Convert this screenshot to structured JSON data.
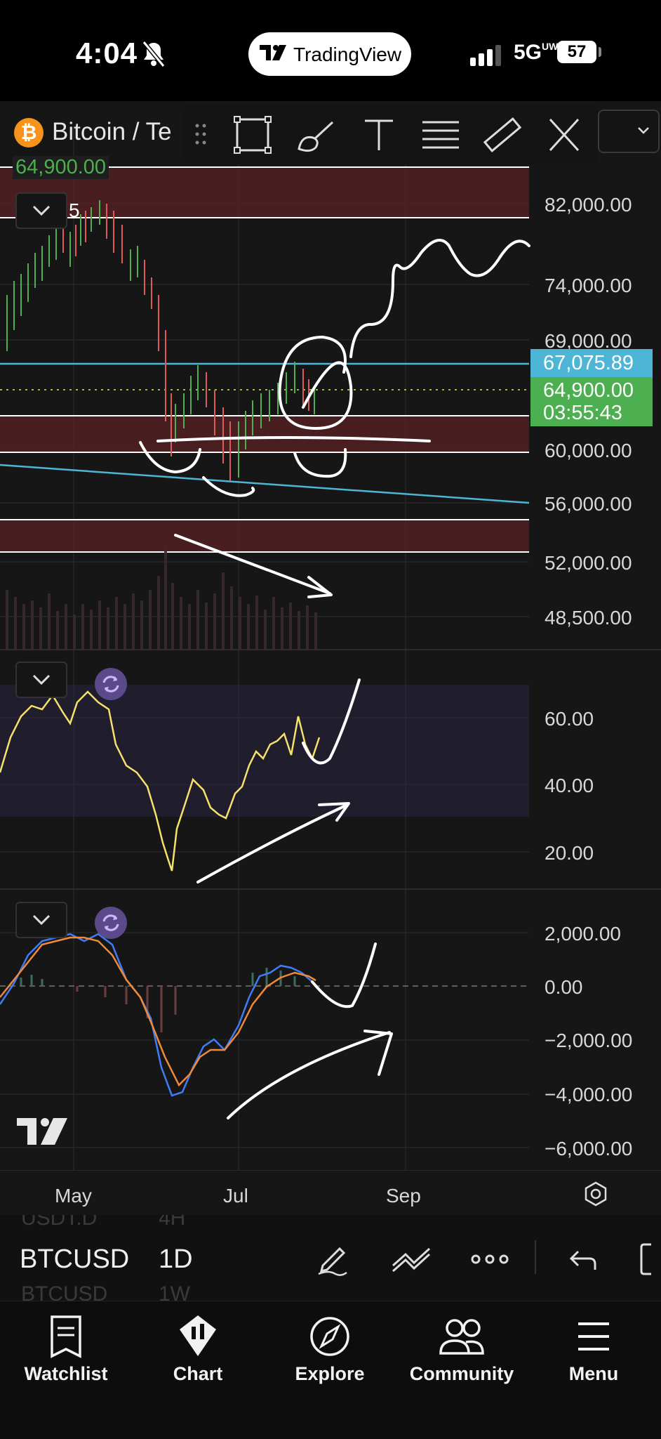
{
  "status_bar": {
    "time": "4:04",
    "network": "5G",
    "network_sub": "UW",
    "battery": "57"
  },
  "app_pill": {
    "label": "TradingView"
  },
  "header": {
    "coin_glyph": "₿",
    "symbol_title": "Bitcoin / Te",
    "last_price": "64,900.00"
  },
  "main_pane": {
    "collapse_count": "5"
  },
  "price_axis": [
    "82,000.00",
    "74,000.00",
    "69,000.00",
    "60,000.00",
    "56,000.00",
    "52,000.00",
    "48,500.00"
  ],
  "price_tags": {
    "level": "67,075.89",
    "current": "64,900.00",
    "countdown": "03:55:43",
    "level_color": "#4db6d6",
    "current_color": "#4caf50"
  },
  "rsi_axis": [
    "60.00",
    "40.00",
    "20.00"
  ],
  "macd_axis": [
    "2,000.00",
    "0.00",
    "−2,000.00",
    "−4,000.00",
    "−6,000.00"
  ],
  "time_axis": [
    "May",
    "Jul",
    "Sep"
  ],
  "bottom_toolbar": {
    "symbol": "BTCUSD",
    "interval": "1D",
    "ghost_prev_symbol": "USDT.D",
    "ghost_prev_interval": "4H",
    "ghost_next_symbol": "BTCUSD",
    "ghost_next_interval": "1W"
  },
  "tabs": [
    {
      "label": "Watchlist",
      "icon": "watchlist-icon"
    },
    {
      "label": "Chart",
      "icon": "chart-icon"
    },
    {
      "label": "Explore",
      "icon": "compass-icon"
    },
    {
      "label": "Community",
      "icon": "community-icon"
    },
    {
      "label": "Menu",
      "icon": "menu-icon"
    }
  ]
}
